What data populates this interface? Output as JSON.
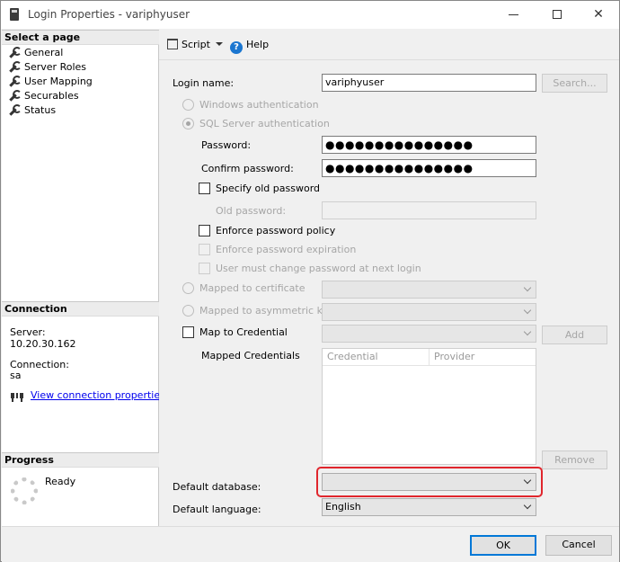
{
  "window": {
    "title": "Login Properties - variphyuser",
    "controls": [
      "minimize-icon",
      "maximize-icon",
      "close-icon"
    ]
  },
  "left_panel": {
    "select_page_header": "Select a page",
    "pages": [
      {
        "label": "General",
        "icon": "wrench-icon"
      },
      {
        "label": "Server Roles",
        "icon": "wrench-icon"
      },
      {
        "label": "User Mapping",
        "icon": "wrench-icon"
      },
      {
        "label": "Securables",
        "icon": "wrench-icon"
      },
      {
        "label": "Status",
        "icon": "wrench-icon"
      }
    ],
    "connection_header": "Connection",
    "server_label": "Server:",
    "server_value": "10.20.30.162",
    "connection_label": "Connection:",
    "connection_value": "sa",
    "view_connection_link": "View connection properties",
    "progress_header": "Progress",
    "progress_status": "Ready"
  },
  "toolbar": {
    "script_label": "Script",
    "help_label": "Help"
  },
  "form": {
    "login_name_label": "Login name:",
    "login_name_value": "variphyuser",
    "search_button": "Search...",
    "windows_auth_label": "Windows authentication",
    "sql_auth_label": "SQL Server authentication",
    "password_label": "Password:",
    "password_value": "●●●●●●●●●●●●●●●",
    "confirm_password_label": "Confirm password:",
    "confirm_password_value": "●●●●●●●●●●●●●●●",
    "specify_old_password_label": "Specify old password",
    "old_password_label": "Old password:",
    "enforce_policy_label": "Enforce password policy",
    "enforce_expiration_label": "Enforce password expiration",
    "must_change_label": "User must change password at next login",
    "mapped_certificate_label": "Mapped to certificate",
    "mapped_asymmetric_label": "Mapped to asymmetric key",
    "map_credential_label": "Map to Credential",
    "add_button": "Add",
    "mapped_credentials_label": "Mapped Credentials",
    "grid_columns": [
      "Credential",
      "Provider"
    ],
    "remove_button": "Remove",
    "default_database_label": "Default database:",
    "default_database_value": "",
    "default_language_label": "Default language:",
    "default_language_value": "English"
  },
  "footer": {
    "ok_button": "OK",
    "cancel_button": "Cancel"
  },
  "colors": {
    "highlight_border": "#e0262d",
    "link": "#0000ee",
    "ok_border": "#0078d7"
  }
}
